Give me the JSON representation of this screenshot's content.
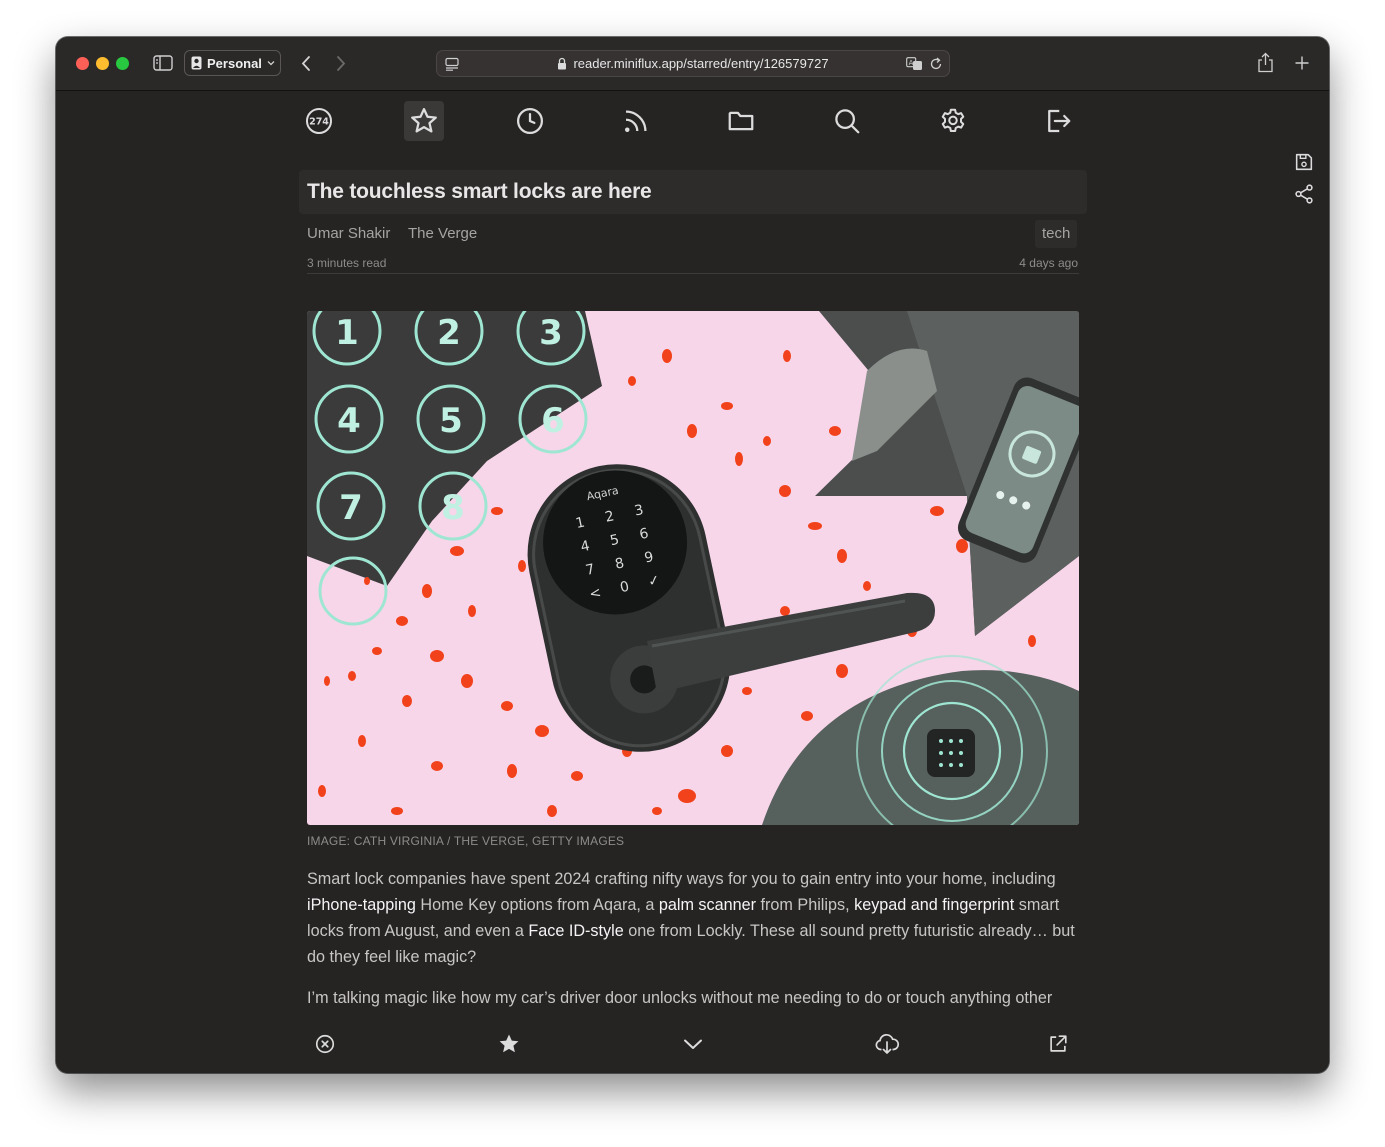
{
  "browser": {
    "profile_label": "Personal",
    "url": "reader.miniflux.app/starred/entry/126579727"
  },
  "nav": {
    "unread_count": "274"
  },
  "article": {
    "title": "The touchless smart locks are here",
    "author": "Umar Shakir",
    "feed": "The Verge",
    "tag": "tech",
    "reading_time": "3 minutes read",
    "published": "4 days ago",
    "image_caption": "IMAGE: CATH VIRGINIA / THE VERGE, GETTY IMAGES",
    "paragraph1": {
      "t1": "Smart lock companies have spent 2024 crafting nifty ways for you to gain entry into your home, including ",
      "l1": "iPhone-tapping",
      "t2": " Home Key options from Aqara, a ",
      "l2": "palm scanner",
      "t3": " from Philips, ",
      "l3": "keypad and fingerprint",
      "t4": " smart locks from August, and even a ",
      "l4": "Face ID-style",
      "t5": " one from Lockly. These all sound pretty futuristic already… but do they feel like magic?"
    },
    "paragraph2": "I’m talking magic like how my car’s driver door unlocks without me needing to do or touch anything other",
    "image_keypad": [
      "1",
      "2",
      "3",
      "4",
      "5",
      "6",
      "7",
      "8"
    ],
    "image_lock_brand": "Aqara",
    "image_lock_keys": [
      "1",
      "2",
      "3",
      "4",
      "5",
      "6",
      "7",
      "8",
      "9",
      "<",
      "0",
      "✓"
    ]
  },
  "colors": {
    "background": "#262323",
    "title_box": "#2e2b2b",
    "image_pink": "#f7d6ea",
    "image_orange": "#f2421b",
    "image_teal": "#9fe6d2"
  },
  "icons": {
    "top_nav": [
      "unread-counter-icon",
      "star-icon",
      "history-icon",
      "feeds-icon",
      "categories-icon",
      "search-icon",
      "settings-icon",
      "logout-icon"
    ],
    "bottom_actions": [
      "mark-unread-icon",
      "star-filled-icon",
      "chevron-down-icon",
      "download-icon",
      "external-link-icon"
    ],
    "side": [
      "save-icon",
      "share-icon"
    ]
  }
}
